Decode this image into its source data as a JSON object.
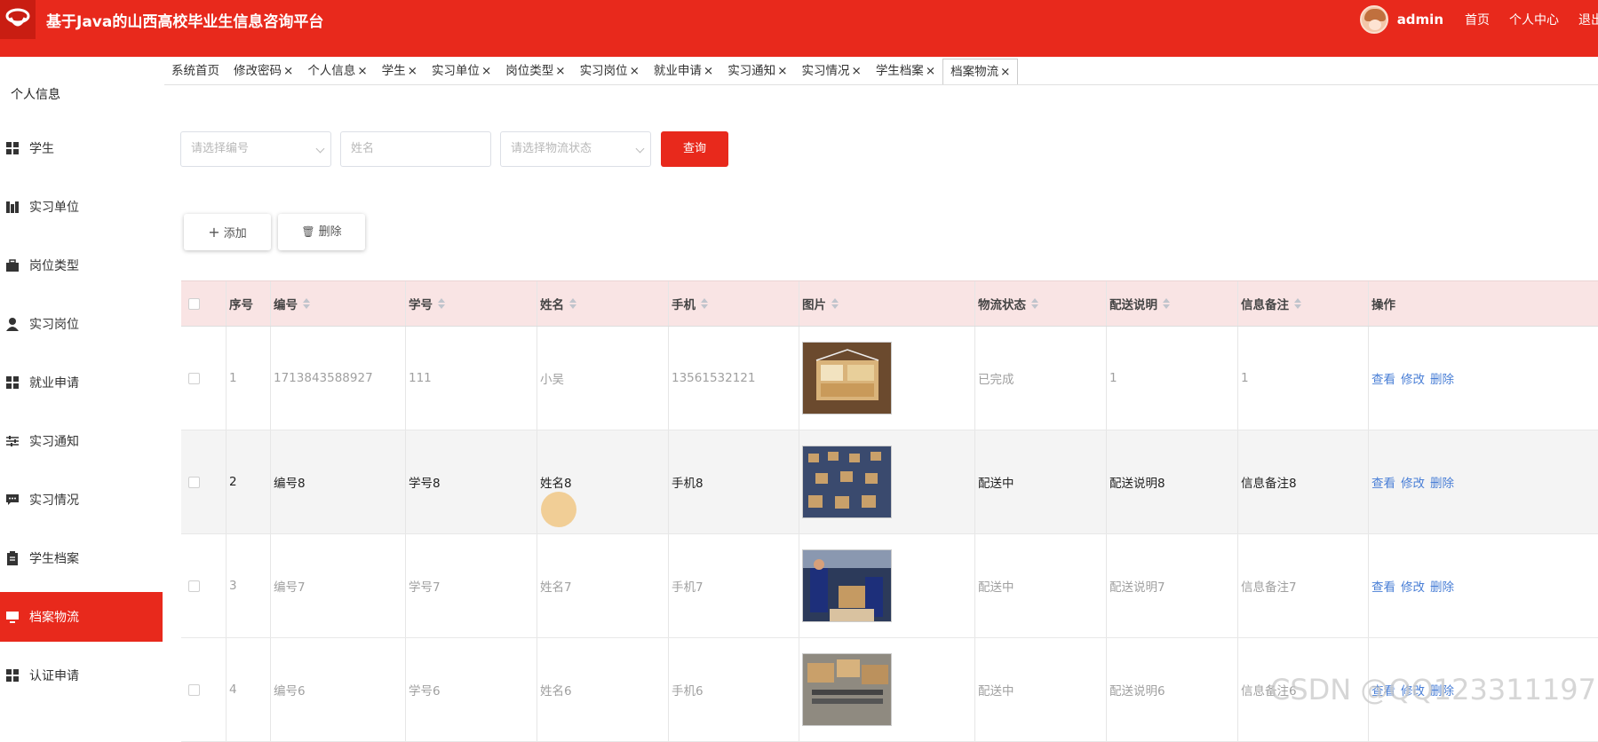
{
  "header": {
    "title": "基于Java的山西高校毕业生信息咨询平台",
    "user": "admin",
    "links": [
      "首页",
      "个人中心",
      "退出"
    ]
  },
  "sidebar": {
    "heading": "个人信息",
    "items": [
      {
        "label": "学生",
        "icon": "grid-icon"
      },
      {
        "label": "实习单位",
        "icon": "building-icon"
      },
      {
        "label": "岗位类型",
        "icon": "briefcase-icon"
      },
      {
        "label": "实习岗位",
        "icon": "user-icon"
      },
      {
        "label": "就业申请",
        "icon": "grid-icon"
      },
      {
        "label": "实习通知",
        "icon": "sliders-icon"
      },
      {
        "label": "实习情况",
        "icon": "chat-icon"
      },
      {
        "label": "学生档案",
        "icon": "clipboard-icon"
      },
      {
        "label": "档案物流",
        "icon": "monitor-icon"
      },
      {
        "label": "认证申请",
        "icon": "grid-icon"
      }
    ],
    "active_index": 8
  },
  "tabs": [
    "系统首页",
    "修改密码",
    "个人信息",
    "学生",
    "实习单位",
    "岗位类型",
    "实习岗位",
    "就业申请",
    "实习通知",
    "实习情况",
    "学生档案",
    "档案物流"
  ],
  "tab_close": "×",
  "search": {
    "number_placeholder": "请选择编号",
    "name_placeholder": "姓名",
    "status_placeholder": "请选择物流状态",
    "query_label": "查询"
  },
  "toolbar": {
    "add_label": "添加",
    "delete_label": "删除"
  },
  "table": {
    "headers": [
      "序号",
      "编号",
      "学号",
      "姓名",
      "手机",
      "图片",
      "物流状态",
      "配送说明",
      "信息备注",
      "操作"
    ],
    "rows": [
      {
        "idx": "1",
        "no": "1713843588927",
        "sid": "111",
        "name": "小吴",
        "phone": "13561532121",
        "status": "已完成",
        "desc": "1",
        "note": "1"
      },
      {
        "idx": "2",
        "no": "编号8",
        "sid": "学号8",
        "name": "姓名8",
        "phone": "手机8",
        "status": "配送中",
        "desc": "配送说明8",
        "note": "信息备注8"
      },
      {
        "idx": "3",
        "no": "编号7",
        "sid": "学号7",
        "name": "姓名7",
        "phone": "手机7",
        "status": "配送中",
        "desc": "配送说明7",
        "note": "信息备注7"
      },
      {
        "idx": "4",
        "no": "编号6",
        "sid": "学号6",
        "name": "姓名6",
        "phone": "手机6",
        "status": "配送中",
        "desc": "配送说明6",
        "note": "信息备注6"
      }
    ],
    "actions": [
      "查看",
      "修改",
      "删除"
    ]
  },
  "watermark": "CSDN @QQ123311197",
  "colors": {
    "brand": "#e8291c",
    "link": "#4a7fd6",
    "header_row": "#f9e4e4"
  }
}
